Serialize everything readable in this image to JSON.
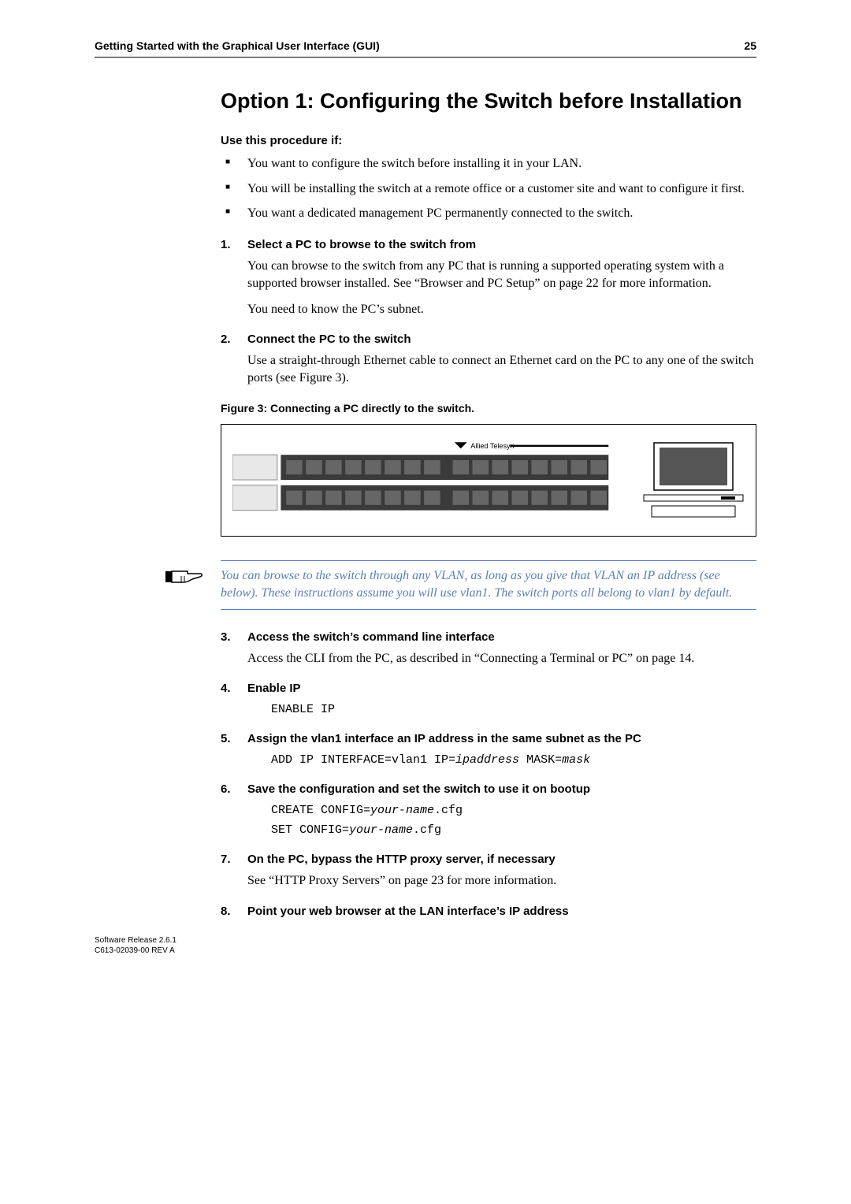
{
  "header": {
    "title": "Getting Started with the Graphical User Interface (GUI)",
    "page": "25"
  },
  "section_title": "Option 1: Configuring the Switch before Installation",
  "intro_subhead": "Use this procedure if:",
  "bullets": [
    "You want to configure the switch before installing it in your LAN.",
    "You will be installing the switch at a remote office or a customer site and want to configure it first.",
    "You want a dedicated management PC permanently connected to the switch."
  ],
  "steps": {
    "s1": {
      "num": "1.",
      "title": "Select a PC to browse to the switch from",
      "p1": "You can browse to the switch from any PC that is running a supported operating system with a supported browser installed. See “Browser and PC Setup” on page 22 for more information.",
      "p2": "You need to know the PC’s subnet."
    },
    "s2": {
      "num": "2.",
      "title": "Connect the PC to the switch",
      "p1": "Use a straight-through Ethernet cable to connect an Ethernet card on the PC to any one of the switch ports (see Figure 3)."
    },
    "figure_caption": "Figure 3: Connecting a PC directly to the switch.",
    "figure_label": "Allied Telesyn",
    "note": "You can browse to the switch through any VLAN, as long as you give that VLAN an IP address (see below). These instructions assume you will use vlan1. The switch ports all belong to vlan1 by default.",
    "s3": {
      "num": "3.",
      "title": "Access the switch’s command line interface",
      "p1": "Access the CLI from the PC, as described in “Connecting a Terminal or PC” on page 14."
    },
    "s4": {
      "num": "4.",
      "title": "Enable IP",
      "code": "ENABLE IP"
    },
    "s5": {
      "num": "5.",
      "title": "Assign the vlan1 interface an IP address in the same subnet as the PC",
      "code_prefix": "ADD IP INTERFACE=vlan1 IP=",
      "code_var1": "ipaddress",
      "code_mid": " MASK=",
      "code_var2": "mask"
    },
    "s6": {
      "num": "6.",
      "title": "Save the configuration and set the switch to use it on bootup",
      "code1_prefix": "CREATE CONFIG=",
      "code1_var": "your-name",
      "code1_suffix": ".cfg",
      "code2_prefix": "SET CONFIG=",
      "code2_var": "your-name",
      "code2_suffix": ".cfg"
    },
    "s7": {
      "num": "7.",
      "title": "On the PC, bypass the HTTP proxy server, if necessary",
      "p1": "See “HTTP Proxy Servers” on page 23 for more information."
    },
    "s8": {
      "num": "8.",
      "title": "Point your web browser at the LAN interface’s IP address"
    }
  },
  "footer": {
    "line1": "Software Release 2.6.1",
    "line2": "C613-02039-00 REV A"
  }
}
